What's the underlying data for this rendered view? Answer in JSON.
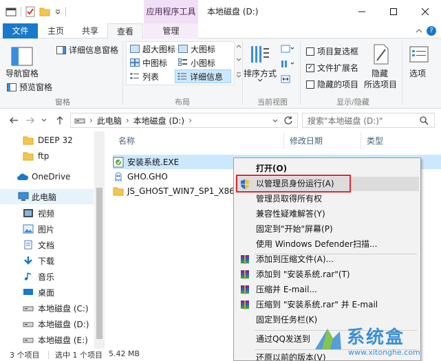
{
  "window": {
    "title": "本地磁盘 (D:)",
    "context_tab_title": "应用程序工具"
  },
  "tabs": {
    "file": "文件",
    "home": "主页",
    "share": "共享",
    "view": "查看",
    "manage": "管理"
  },
  "ribbon": {
    "panes": {
      "nav_pane": "导航窗格",
      "preview_pane": "预览窗格",
      "details_pane": "详细信息窗格",
      "label": "窗格"
    },
    "layout": {
      "items": [
        "超大图标",
        "大图标",
        "中图标",
        "小图标",
        "列表",
        "详细信息"
      ],
      "label": "布局"
    },
    "current_view": {
      "sort_by": "排序方式",
      "label": "当前视图"
    },
    "show_hide": {
      "item_checkboxes": "项目复选框",
      "file_extensions": "文件扩展名",
      "hidden_items": "隐藏的项目",
      "hide_selected_line1": "隐藏",
      "hide_selected_line2": "所选项目",
      "label": "显示/隐藏"
    },
    "options": "选项"
  },
  "address": {
    "crumbs": [
      "此电脑",
      "本地磁盘 (D:)"
    ],
    "search_placeholder": "搜索\"本地磁盘 (D:)\""
  },
  "nav": {
    "items": [
      "DEEP 32",
      "ftp",
      "OneDrive",
      "此电脑",
      "视频",
      "图片",
      "文档",
      "下载",
      "音乐",
      "桌面",
      "本地磁盘 (C:)",
      "本地磁盘 (D:)",
      "本地磁盘 (E:)"
    ]
  },
  "columns": {
    "name": "名称",
    "modified": "修改日期",
    "type": "类型"
  },
  "files": [
    {
      "name": "安装系统.EXE"
    },
    {
      "name": "GHO.GHO"
    },
    {
      "name": "JS_GHOST_WIN7_SP1_X86_"
    }
  ],
  "status": {
    "count": "3 个项目",
    "selected": "选中 1 个项目",
    "size": "5.42 MB"
  },
  "context_menu": {
    "items": [
      "打开(O)",
      "以管理员身份运行(A)",
      "管理员取得所有权",
      "兼容性疑难解答(Y)",
      "固定到\"开始\"屏幕(P)",
      "使用 Windows Defender扫描...",
      "添加到压缩文件(A)...",
      "添加到 \"安装系统.rar\"(T)",
      "压缩并 E-mail...",
      "压缩到 \"安装系统.rar\" 并 E-mail",
      "固定到任务栏(K)",
      "通过QQ发送到",
      "还原以前的版本(V)"
    ]
  },
  "watermark": {
    "brand": "系统盒",
    "url": "www.xitonghe.com"
  },
  "colors": {
    "file_tab": "#1979ca",
    "context_tab": "#f1dff5",
    "selection": "#cce8ff",
    "highlight_border": "#e3262a",
    "watermark": "#3a8fd6"
  }
}
